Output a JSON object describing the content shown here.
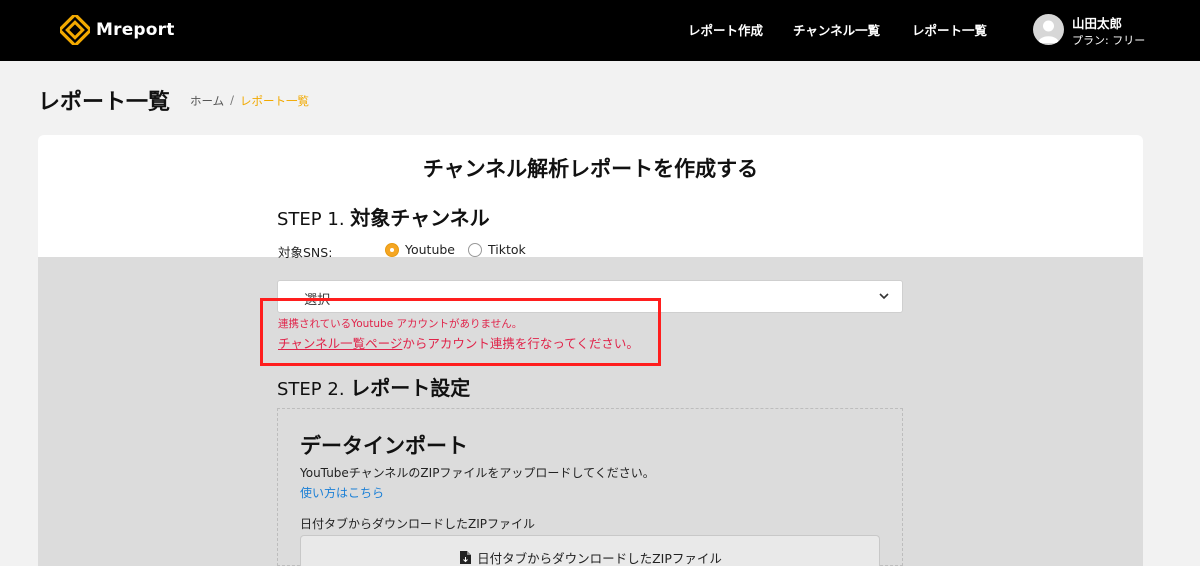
{
  "header": {
    "logo_text": "Mreport",
    "nav": [
      "レポート作成",
      "チャンネル一覧",
      "レポート一覧"
    ],
    "user": {
      "name": "山田太郎",
      "plan": "プラン: フリー"
    }
  },
  "page": {
    "title": "レポート一覧",
    "breadcrumb": {
      "home": "ホーム",
      "separator": "/",
      "current": "レポート一覧"
    }
  },
  "card": {
    "title": "チャンネル解析レポートを作成する",
    "step1": {
      "num": "STEP 1.",
      "title": "対象チャンネル"
    },
    "sns_label": "対象SNS:",
    "sns_options": [
      {
        "label": "Youtube",
        "selected": true
      },
      {
        "label": "Tiktok",
        "selected": false
      }
    ],
    "select_placeholder": "---選択---",
    "error": {
      "line1": "連携されているYoutube アカウントがありません。",
      "link_text": "チャンネル一覧ページ",
      "line2_rest": "からアカウント連携を行なってください。"
    },
    "step2": {
      "num": "STEP 2.",
      "title": "レポート設定"
    },
    "import": {
      "title": "データインポート",
      "description": "YouTubeチャンネルのZIPファイルをアップロードしてください。",
      "howto_link": "使い方はこちら",
      "zip_label": "日付タブからダウンロードしたZIPファイル",
      "zip_button": "日付タブからダウンロードしたZIPファイル"
    }
  },
  "colors": {
    "accent": "#f2a900",
    "error": "#e0244a",
    "error_border": "#ff1e1e",
    "link": "#1a7fd6"
  }
}
